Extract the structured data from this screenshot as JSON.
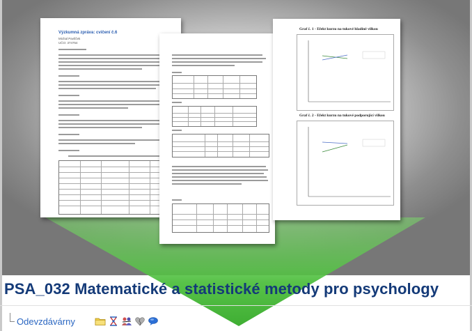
{
  "course": {
    "title": "PSA_032 Matematické a statistické metody pro psychology",
    "submenu_link": "Odevzdávárny"
  },
  "documents": {
    "doc1": {
      "heading": "Výzkumná zpráva: cvičení č.6",
      "author": "Michal Pavlíček",
      "uco": "UČO: 374754"
    },
    "doc3": {
      "chart1_title": "Graf č. 1 - Efekt kurzu na tukové hladině vilkou",
      "chart2_title": "Graf č. 2 - Efekt kurzu na tukové podporující vilkou"
    }
  },
  "icons": [
    "folder-icon",
    "hourglass-icon",
    "people-icon",
    "heart-icon",
    "chat-icon"
  ],
  "colors": {
    "title": "#143a78",
    "link": "#2b67c2",
    "funnel": "#5cc24a"
  }
}
